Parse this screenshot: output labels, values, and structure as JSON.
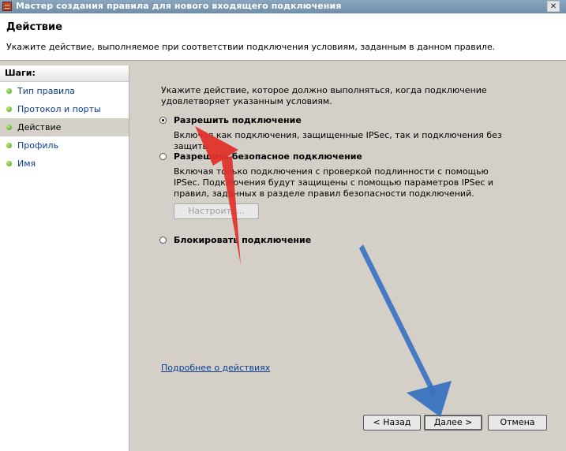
{
  "window": {
    "title": "Мастер создания правила для нового входящего подключения",
    "close_label": "✕"
  },
  "header": {
    "title": "Действие",
    "description": "Укажите действие, выполняемое при соответствии подключения условиям, заданным в данном правиле."
  },
  "sidebar": {
    "steps_title": "Шаги:",
    "items": [
      {
        "label": "Тип правила"
      },
      {
        "label": "Протокол и порты"
      },
      {
        "label": "Действие"
      },
      {
        "label": "Профиль"
      },
      {
        "label": "Имя"
      }
    ]
  },
  "main": {
    "intro": "Укажите действие, которое должно выполняться, когда подключение удовлетворяет указанным условиям.",
    "options": [
      {
        "label": "Разрешить подключение",
        "description": "Включая как подключения, защищенные IPSec, так и подключения без защиты.",
        "selected": true
      },
      {
        "label": "Разрешить безопасное подключение",
        "description": "Включая только подключения с проверкой подлинности с помощью IPSec. Подключения будут защищены с помощью параметров IPSec и правил, заданных в разделе правил безопасности подключений.",
        "selected": false
      },
      {
        "label": "Блокировать подключение",
        "description": "",
        "selected": false
      }
    ],
    "configure_button": "Настроить...",
    "learn_more_link": "Подробнее о действиях"
  },
  "footer": {
    "back_button": "< Назад",
    "next_button": "Далее >",
    "cancel_button": "Отмена"
  },
  "colors": {
    "titlebar": "#7d9bb5",
    "background": "#d4d0c8",
    "link": "#0b3c8f",
    "red_arrow": "#e0312b",
    "blue_arrow": "#3a72c2"
  }
}
